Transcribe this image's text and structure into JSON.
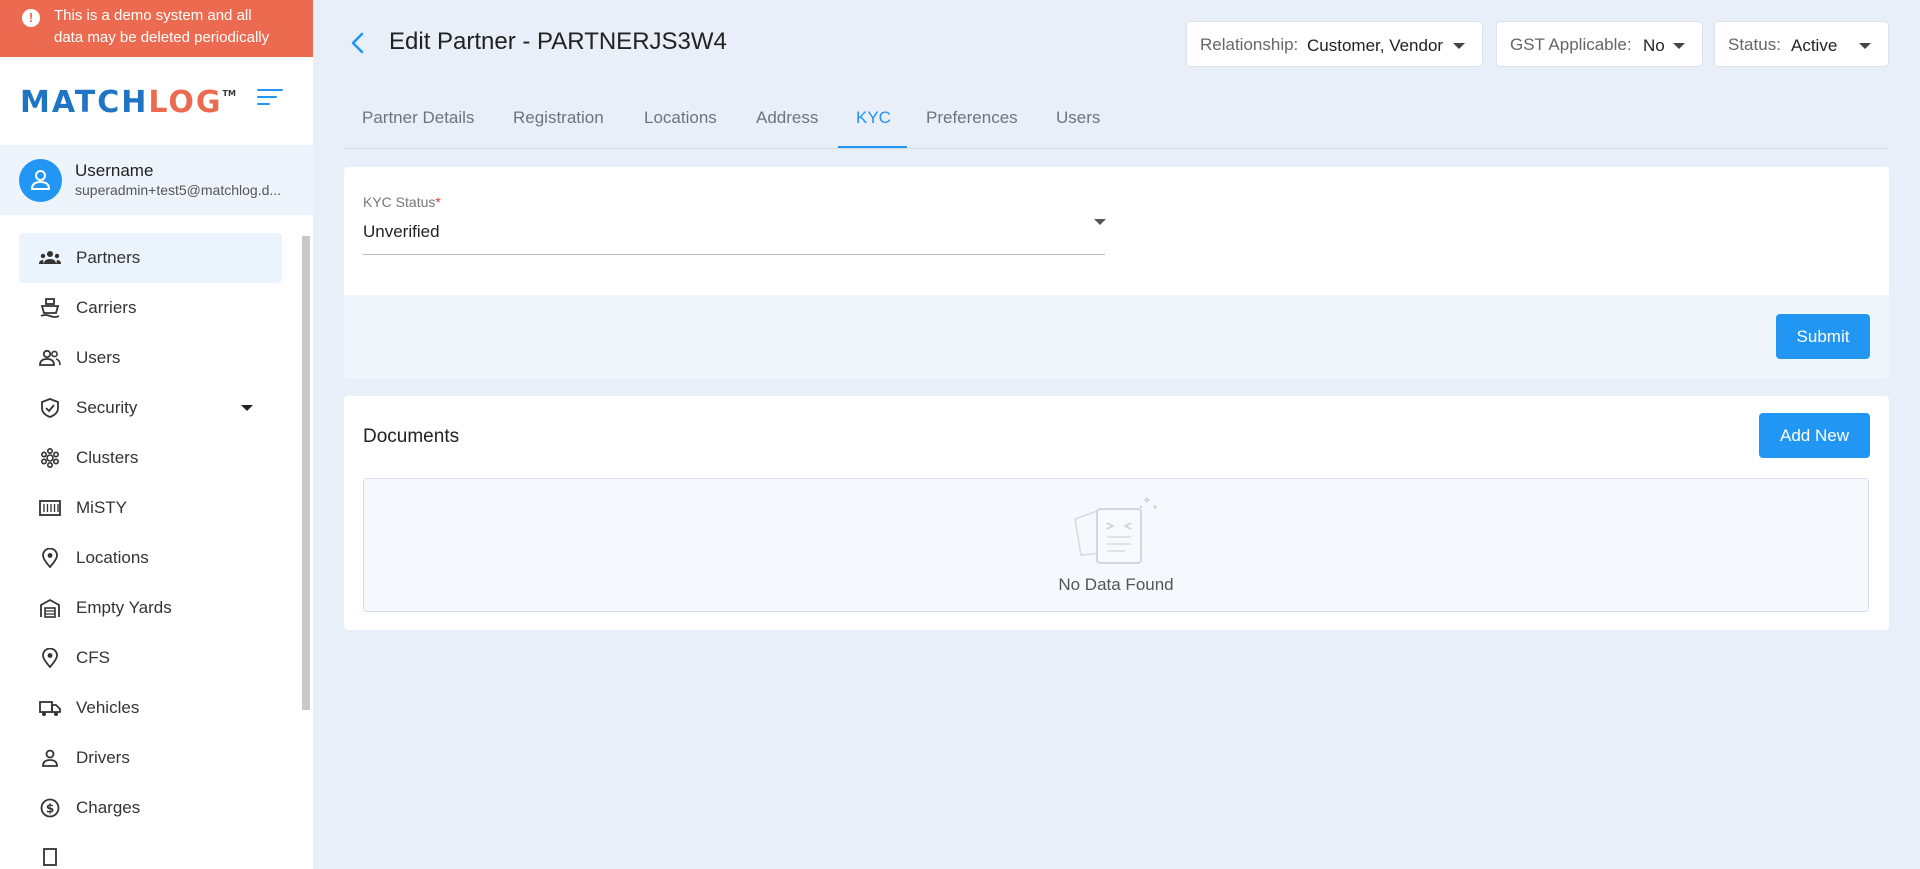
{
  "demo_banner": {
    "text_line1": "This is a demo system and all",
    "text_line2": "data may be deleted periodically"
  },
  "logo": {
    "part1": "MATCH",
    "part2": "LOG",
    "tm": "TM"
  },
  "user": {
    "name": "Username",
    "email": "superadmin+test5@matchlog.d..."
  },
  "sidebar": {
    "items": [
      {
        "label": "Partners",
        "icon": "partners-icon"
      },
      {
        "label": "Carriers",
        "icon": "ship-icon"
      },
      {
        "label": "Users",
        "icon": "users-icon"
      },
      {
        "label": "Security",
        "icon": "shield-icon"
      },
      {
        "label": "Clusters",
        "icon": "clusters-icon"
      },
      {
        "label": "MiSTY",
        "icon": "container-icon"
      },
      {
        "label": "Locations",
        "icon": "location-pin-icon"
      },
      {
        "label": "Empty Yards",
        "icon": "warehouse-icon"
      },
      {
        "label": "CFS",
        "icon": "location-pin-icon"
      },
      {
        "label": "Vehicles",
        "icon": "truck-icon"
      },
      {
        "label": "Drivers",
        "icon": "person-icon"
      },
      {
        "label": "Charges",
        "icon": "dollar-icon"
      }
    ]
  },
  "header": {
    "title": "Edit Partner - PARTNERJS3W4",
    "relationship": {
      "label": "Relationship:",
      "value": "Customer, Vendor"
    },
    "gst": {
      "label": "GST Applicable:",
      "value": "No"
    },
    "status": {
      "label": "Status:",
      "value": "Active"
    }
  },
  "tabs": [
    "Partner Details",
    "Registration",
    "Locations",
    "Address",
    "KYC",
    "Preferences",
    "Users"
  ],
  "active_tab": "KYC",
  "kyc": {
    "label": "KYC Status",
    "required_mark": "*",
    "value": "Unverified",
    "submit_label": "Submit"
  },
  "documents": {
    "title": "Documents",
    "add_label": "Add New",
    "empty_text": "No Data Found"
  },
  "colors": {
    "primary": "#2196f3",
    "banner": "#ec6b50",
    "background": "#e9eff8"
  }
}
